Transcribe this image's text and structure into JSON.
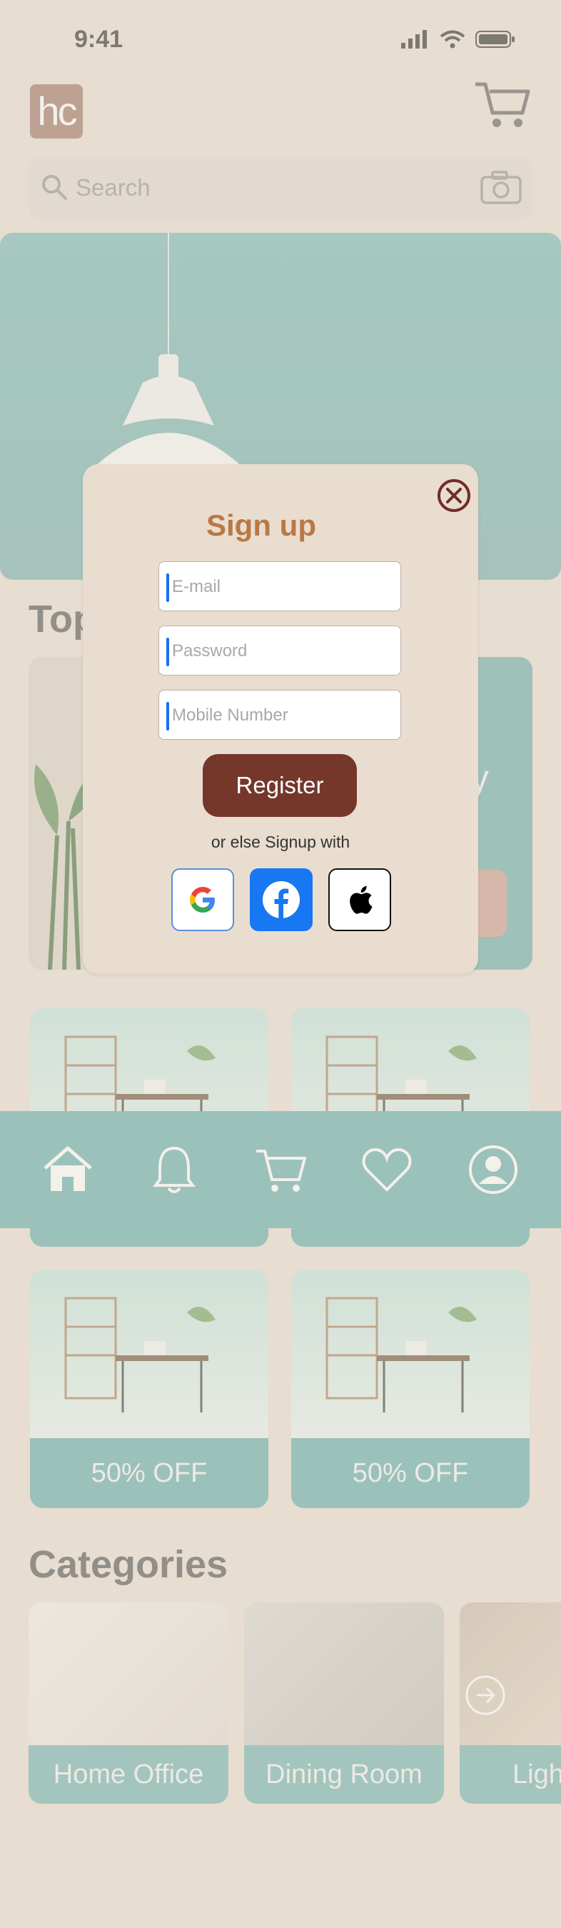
{
  "status_bar": {
    "time": "9:41"
  },
  "header": {
    "logo_text": "hc"
  },
  "search": {
    "placeholder": "Search"
  },
  "sections": {
    "top_title": "Top",
    "promo_word": "ay"
  },
  "offers": [
    {
      "label": "50% OFF"
    },
    {
      "label": "50% OFF"
    },
    {
      "label": "50% OFF"
    },
    {
      "label": "50% OFF"
    }
  ],
  "categories": {
    "title": "Categories",
    "items": [
      {
        "label": "Home Office"
      },
      {
        "label": "Dining Room"
      },
      {
        "label": "Ligh"
      }
    ]
  },
  "tab_bar": {
    "items": [
      {
        "icon": "home-icon"
      },
      {
        "icon": "bell-icon"
      },
      {
        "icon": "cart-icon"
      },
      {
        "icon": "heart-icon"
      },
      {
        "icon": "profile-icon"
      }
    ]
  },
  "modal": {
    "title": "Sign up",
    "email_placeholder": "E-mail",
    "password_placeholder": "Password",
    "mobile_placeholder": "Mobile Number",
    "register_label": "Register",
    "or_text": "or else Signup with",
    "social": [
      "google-icon",
      "facebook-icon",
      "apple-icon"
    ]
  },
  "colors": {
    "background": "#e7ddd1",
    "accent_teal": "#5eaaa9",
    "register_button": "#74372a",
    "title_brown": "#b97945",
    "facebook_blue": "#1877f2"
  }
}
